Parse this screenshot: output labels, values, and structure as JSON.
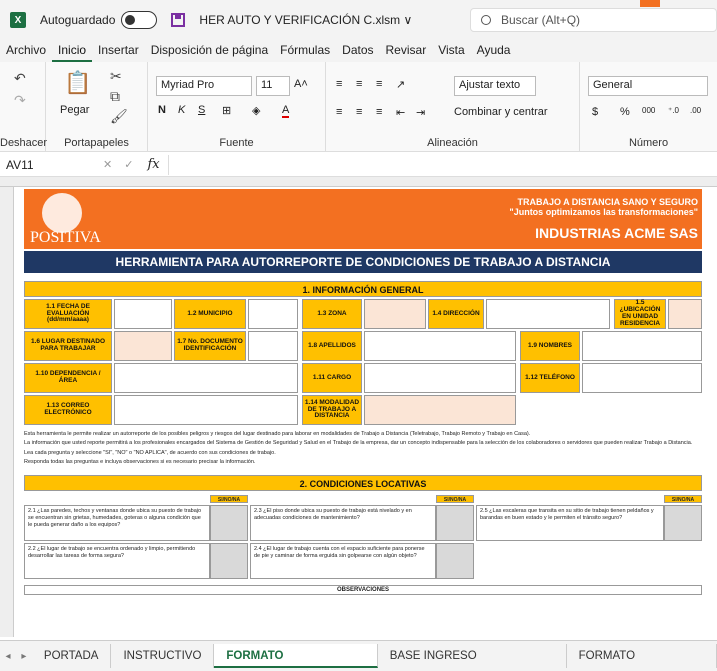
{
  "app": {
    "autosave_label": "Autoguardado",
    "filename": "HER AUTO Y VERIFICACIÓN C.xlsm ∨",
    "search_placeholder": "Buscar (Alt+Q)"
  },
  "menu": [
    "Archivo",
    "Inicio",
    "Insertar",
    "Disposición de página",
    "Fórmulas",
    "Datos",
    "Revisar",
    "Vista",
    "Ayuda"
  ],
  "ribbon": {
    "undo_group": "Deshacer",
    "clipboard_group": "Portapapeles",
    "paste_label": "Pegar",
    "font_group": "Fuente",
    "font_name": "Myriad Pro",
    "font_size": "11",
    "alignment_group": "Alineación",
    "wrap_text": "Ajustar texto",
    "merge_center": "Combinar y centrar",
    "number_group": "Número",
    "number_format": "General"
  },
  "formula_bar": {
    "cell_ref": "AV11"
  },
  "sheet": {
    "banner": {
      "logo_text": "POSITIVA",
      "tag1": "TRABAJO A DISTANCIA SANO Y SEGURO",
      "tag2": "\"Juntos optimizamos las transformaciones\"",
      "company": "INDUSTRIAS ACME SAS"
    },
    "main_title": "HERRAMIENTA PARA AUTORREPORTE DE CONDICIONES DE TRABAJO A DISTANCIA",
    "section1": "1. INFORMACIÓN GENERAL",
    "fields": {
      "f11": "1.1 FECHA DE EVALUACIÓN (dd/mm/aaaa)",
      "f12": "1.2 MUNICIPIO",
      "f13": "1.3 ZONA",
      "f14": "1.4 DIRECCIÓN",
      "f15": "1.5 ¿UBICACIÓN EN UNIDAD RESIDENCIA",
      "f16": "1.6 LUGAR DESTINADO PARA TRABAJAR",
      "f17": "1.7 No. DOCUMENTO IDENTIFICACIÓN",
      "f18": "1.8 APELLIDOS",
      "f19": "1.9 NOMBRES",
      "f110": "1.10 DEPENDENCIA / ÁREA",
      "f111": "1.11 CARGO",
      "f112": "1.12 TELÉFONO",
      "f113": "1.13 CORREO ELECTRÓNICO",
      "f114": "1.14 MODALIDAD DE TRABAJO A DISTANCIA"
    },
    "notes": {
      "n1": "Esta herramienta le permite realizar un autorreporte de los posibles peligros y riesgos del lugar destinado para laborar en modalidades de Trabajo a Distancia (Teletrabajo, Trabajo Remoto y Trabajo en Casa).",
      "n2": "La información que usted reporte permitirá a los profesionales encargados del Sistema de Gestión de Seguridad y Salud en el Trabajo de la empresa, dar un concepto indispensable para la selección de los colaboradores o servidores que pueden realizar Trabajo a Distancia.",
      "n3": "Lea cada pregunta y seleccione \"SI\", \"NO\" o \"NO APLICA\", de acuerdo con sus condiciones de trabajo.",
      "n4": "Responda todas las preguntas e incluya observaciones si es necesario precisar la información."
    },
    "section2": "2. CONDICIONES LOCATIVAS",
    "answer_header": "SI/NO/NA",
    "questions": {
      "q21": "2.1 ¿Las paredes, techos y ventanas donde ubica su puesto de trabajo se encuentran sin grietas, humedades, goteras o alguna condición que le pueda generar daño a los equipos?",
      "q22": "2.2 ¿El lugar de trabajo se encuentra ordenado y limpio, permitiendo desarrollar las tareas de forma segura?",
      "q23": "2.3 ¿El piso donde ubica su puesto de trabajo está nivelado y en adecuadas condiciones de mantenimiento?",
      "q24": "2.4 ¿El lugar de trabajo cuenta con el espacio suficiente para ponerse de pie y caminar de forma erguida sin golpearse con algún objeto?",
      "q25": "2.5 ¿Las escaleras que transita en su sitio de trabajo tienen peldaños y barandas en buen estado y le permiten el tránsito seguro?"
    },
    "observations": "OBSERVACIONES"
  },
  "tabs": [
    "PORTADA",
    "INSTRUCTIVO",
    "FORMATO AUTORREPORTE",
    "BASE INGRESO AUTORREPORTE",
    "FORMATO VERIFICACIÓN"
  ],
  "active_tab": "FORMATO AUTORREPORTE"
}
